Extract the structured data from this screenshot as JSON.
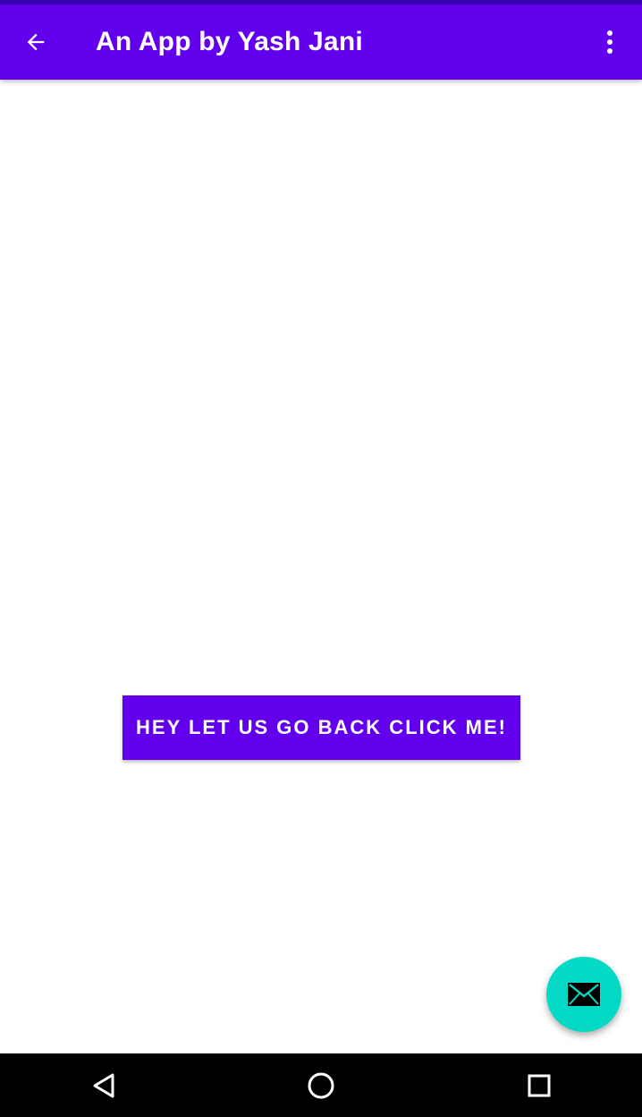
{
  "app_bar": {
    "title": "An App by Yash Jani",
    "back_icon": "arrow-back-icon",
    "overflow_icon": "more-vert-icon",
    "background_color": "#6200ee",
    "status_strip_color": "#3700b3",
    "text_color": "#ffffff"
  },
  "main": {
    "go_back_button_label": "HEY LET US GO BACK CLICK ME!",
    "button_color": "#6200ee"
  },
  "fab": {
    "icon": "email-icon",
    "color": "#03dac5"
  },
  "system_nav": {
    "back_icon": "nav-back-triangle-icon",
    "home_icon": "nav-home-circle-icon",
    "recents_icon": "nav-recents-square-icon",
    "background_color": "#000000"
  }
}
